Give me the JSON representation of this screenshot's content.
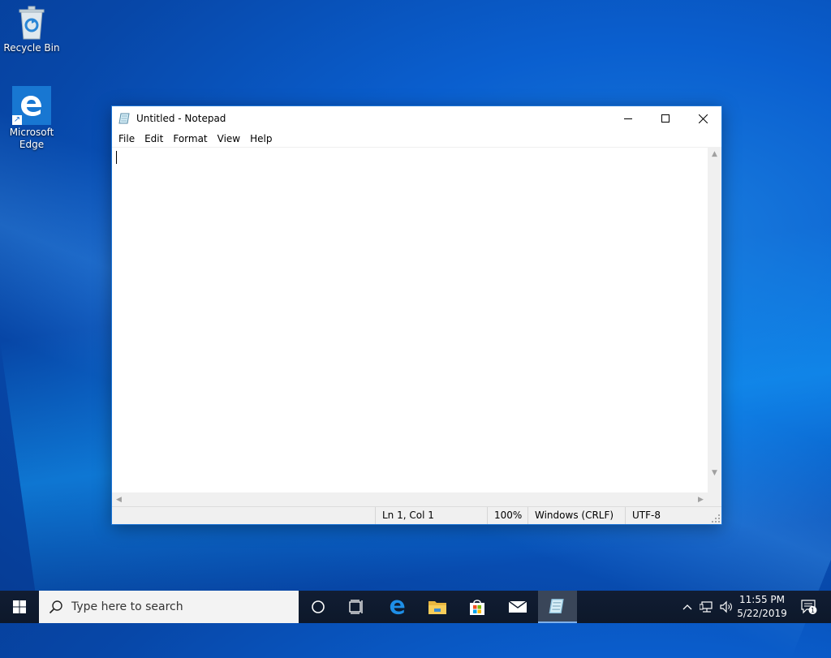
{
  "desktop": {
    "icons": [
      {
        "label": "Recycle Bin",
        "icon": "recycle-bin-icon"
      },
      {
        "label": "Microsoft Edge",
        "icon": "edge-icon"
      }
    ]
  },
  "notepad": {
    "title": "Untitled - Notepad",
    "menu": [
      "File",
      "Edit",
      "Format",
      "View",
      "Help"
    ],
    "content": "",
    "status": {
      "position": "Ln 1, Col 1",
      "zoom": "100%",
      "line_ending": "Windows (CRLF)",
      "encoding": "UTF-8"
    }
  },
  "taskbar": {
    "search_placeholder": "Type here to search",
    "pinned": [
      "task-view-icon",
      "edge-icon",
      "file-explorer-icon",
      "store-icon",
      "mail-icon",
      "notepad-icon"
    ],
    "clock": {
      "time": "11:55 PM",
      "date": "5/22/2019"
    },
    "notification_count": "1"
  },
  "colors": {
    "accent": "#1d74d4",
    "taskbar": "#0f1a2c",
    "desktop": "#0a5fcf"
  }
}
